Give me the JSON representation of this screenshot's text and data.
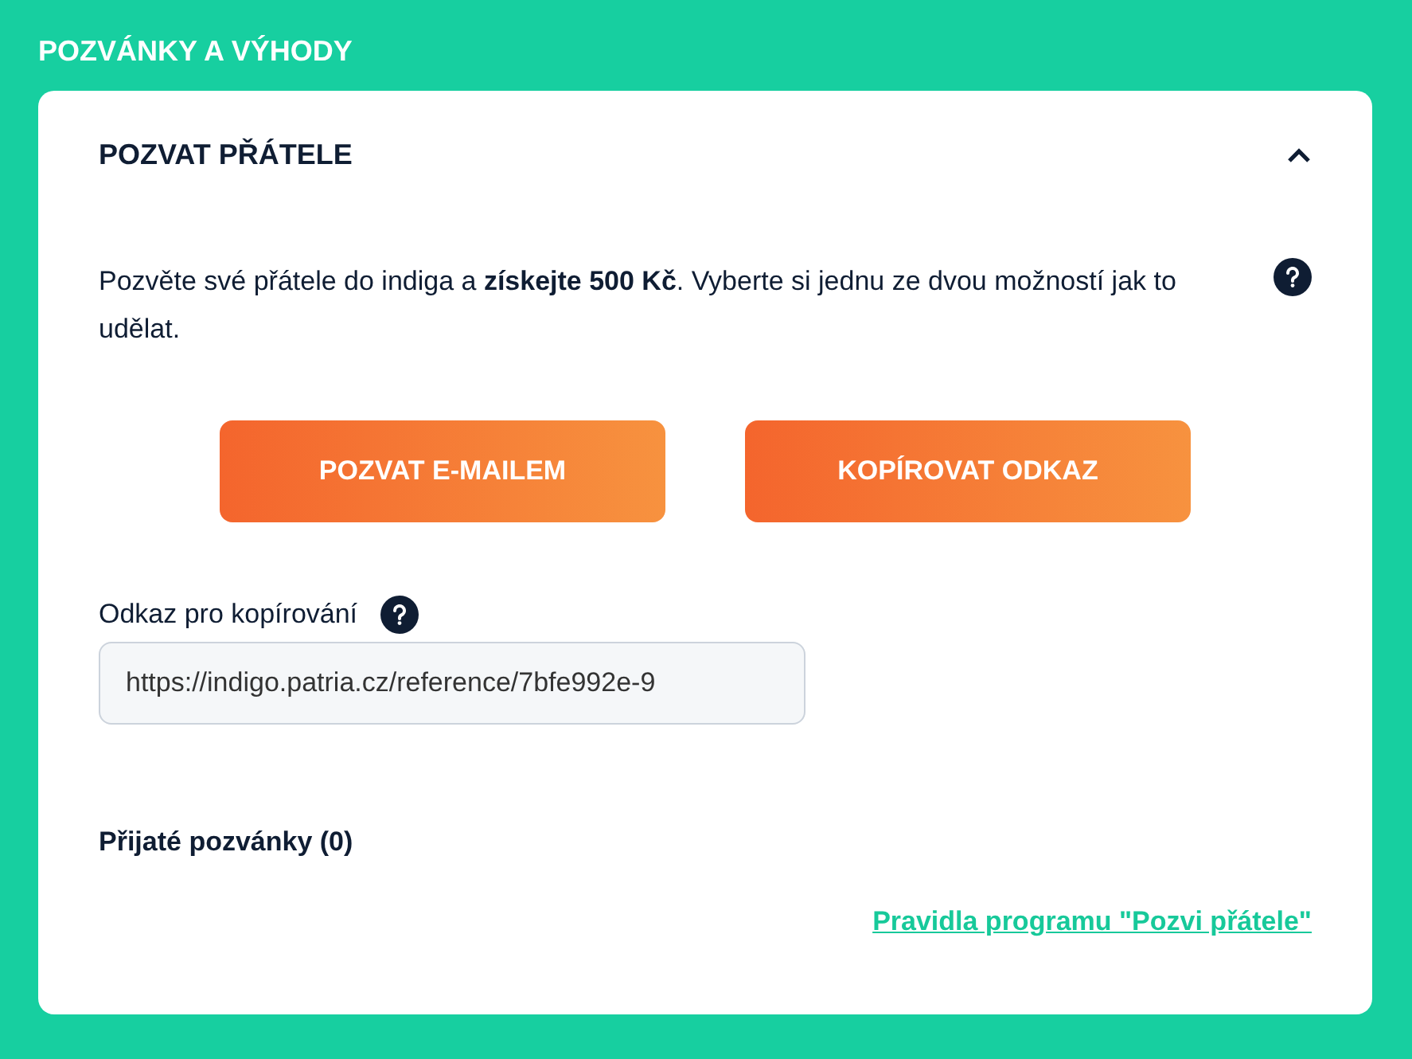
{
  "page_title": "POZVÁNKY A VÝHODY",
  "section": {
    "title": "POZVAT PŘÁTELE",
    "expanded": true,
    "intro": "Pozvěte své přátele do indiga a **získejte 500 Kč**. Vyberte si jednu ze dvou možností jak to udělat.",
    "buttons": [
      "POZVAT E-MAILEM",
      "KOPÍROVAT ODKAZ"
    ],
    "link_field": {
      "label": "Odkaz pro kopírování",
      "value": "https://indigo.patria.cz/reference/7bfe992e-9"
    },
    "received_invitations": "Přijaté pozvánky (0)",
    "rules_link": "Pravidla programu \"Pozvi přátele\""
  }
}
